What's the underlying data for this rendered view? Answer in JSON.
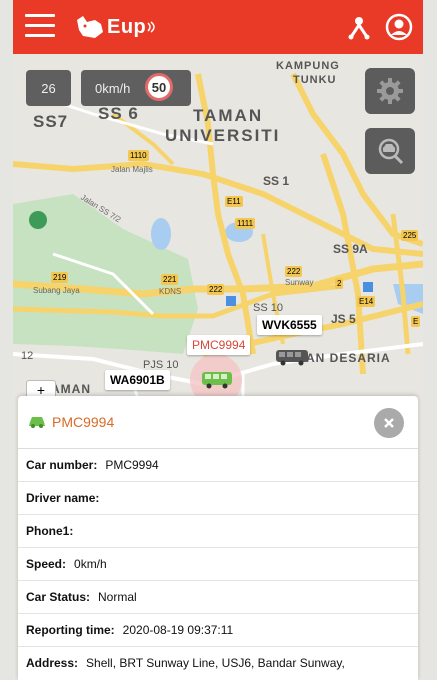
{
  "app": {
    "logo_text": "Eup"
  },
  "overlay": {
    "satellites": "26",
    "speed": "0km/h",
    "speed_limit": "50"
  },
  "map_labels": {
    "kampung": "KAMPUNG",
    "tunku": "TUNKU",
    "ss7": "SS7",
    "ss6": "SS 6",
    "taman": "TAMAN",
    "universiti": "UNIVERSITI",
    "ss1": "SS 1",
    "ss9a": "SS 9A",
    "js5": "JS 5",
    "desaria": "MAN DESARIA",
    "taman_left": "AMAN",
    "ss10": "SS 10",
    "num12": "12",
    "pj10": "PJS 10",
    "jalan_majlis": "Jalan Majlis",
    "subang_jaya": "Subang Jaya",
    "sunway": "Sunway",
    "kdns": "KDNS",
    "jalan_ss72": "Jalan SS 7/2",
    "shields": [
      "1110",
      "E11",
      "1111",
      "219",
      "221",
      "222",
      "222",
      "2",
      "E14",
      "225",
      "E"
    ]
  },
  "vehicles": {
    "wvk": "WVK6555",
    "pmc": "PMC9994",
    "wa": "WA6901B"
  },
  "zoom_plus": "+",
  "panel": {
    "title": "PMC9994",
    "rows": [
      {
        "key": "Car number:",
        "value": "PMC9994"
      },
      {
        "key": "Driver name:",
        "value": ""
      },
      {
        "key": "Phone1:",
        "value": ""
      },
      {
        "key": "Speed:",
        "value": "0km/h"
      },
      {
        "key": "Car Status:",
        "value": "Normal"
      },
      {
        "key": "Reporting time:",
        "value": "2020-08-19 09:37:11"
      },
      {
        "key": "Address:",
        "value": "Shell, BRT Sunway Line, USJ6, Bandar Sunway,"
      }
    ]
  },
  "colors": {
    "topbar": "#e83a26",
    "accent_title": "#d86b25",
    "vehicle": "#6cc04a"
  },
  "icons": [
    "menu-icon",
    "user-tree-icon",
    "account-icon",
    "gear-icon",
    "car-search-icon",
    "close-icon",
    "car-icon",
    "bus-icon"
  ]
}
